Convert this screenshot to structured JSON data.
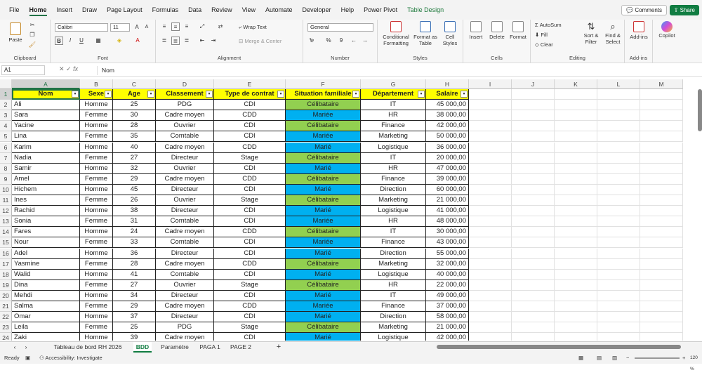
{
  "menu": [
    "File",
    "Home",
    "Insert",
    "Draw",
    "Page Layout",
    "Formulas",
    "Data",
    "Review",
    "View",
    "Automate",
    "Developer",
    "Help",
    "Power Pivot",
    "Table Design"
  ],
  "buttons": {
    "comments": "Comments",
    "share": "Share"
  },
  "ribbon": {
    "clipboard": {
      "paste": "Paste",
      "label": "Clipboard"
    },
    "font": {
      "name": "Calibri",
      "size": "11",
      "label": "Font",
      "bold": "B",
      "italic": "I",
      "underline": "U"
    },
    "alignment": {
      "wrap": "Wrap Text",
      "merge": "Merge & Center",
      "label": "Alignment"
    },
    "number": {
      "format": "General",
      "label": "Number",
      "percent": "%",
      "comma": "9"
    },
    "styles": {
      "conditional": "Conditional Formatting",
      "format_table": "Format as Table",
      "cell_styles": "Cell Styles",
      "label": "Styles"
    },
    "cells": {
      "insert": "Insert",
      "delete": "Delete",
      "format": "Format",
      "label": "Cells"
    },
    "editing": {
      "autosum": "AutoSum",
      "fill": "Fill",
      "clear": "Clear",
      "sort": "Sort & Filter",
      "find": "Find & Select",
      "label": "Editing"
    },
    "addins": {
      "addins": "Add-ins",
      "label": "Add-ins"
    },
    "copilot": {
      "label": "Copilot"
    }
  },
  "formula_bar": {
    "cell_ref": "A1",
    "fx": "fx",
    "value": "Nom"
  },
  "columns": [
    "A",
    "B",
    "C",
    "D",
    "E",
    "F",
    "G",
    "H",
    "I",
    "J",
    "K",
    "L",
    "M"
  ],
  "headers": [
    "Nom",
    "Sexe",
    "Age",
    "Classement",
    "Type de contrat",
    "Situation familiale",
    "Département",
    "Salaire"
  ],
  "rows": [
    [
      "Ali",
      "Homme",
      "25",
      "PDG",
      "CDI",
      "Célibataire",
      "IT",
      "45 000,00"
    ],
    [
      "Sara",
      "Femme",
      "30",
      "Cadre moyen",
      "CDD",
      "Mariée",
      "HR",
      "38 000,00"
    ],
    [
      "Yacine",
      "Homme",
      "28",
      "Ouvrier",
      "CDI",
      "Célibataire",
      "Finance",
      "42 000,00"
    ],
    [
      "Lina",
      "Femme",
      "35",
      "Comtable",
      "CDI",
      "Mariée",
      "Marketing",
      "50 000,00"
    ],
    [
      "Karim",
      "Homme",
      "40",
      "Cadre moyen",
      "CDD",
      "Marié",
      "Logistique",
      "36 000,00"
    ],
    [
      "Nadia",
      "Femme",
      "27",
      "Directeur",
      "Stage",
      "Célibataire",
      "IT",
      "20 000,00"
    ],
    [
      "Samir",
      "Homme",
      "32",
      "Ouvrier",
      "CDI",
      "Marié",
      "HR",
      "47 000,00"
    ],
    [
      "Amel",
      "Femme",
      "29",
      "Cadre moyen",
      "CDD",
      "Célibataire",
      "Finance",
      "39 000,00"
    ],
    [
      "Hichem",
      "Homme",
      "45",
      "Directeur",
      "CDI",
      "Marié",
      "Direction",
      "60 000,00"
    ],
    [
      "Ines",
      "Femme",
      "26",
      "Ouvrier",
      "Stage",
      "Célibataire",
      "Marketing",
      "21 000,00"
    ],
    [
      "Rachid",
      "Homme",
      "38",
      "Directeur",
      "CDI",
      "Marié",
      "Logistique",
      "41 000,00"
    ],
    [
      "Sonia",
      "Femme",
      "31",
      "Comtable",
      "CDI",
      "Mariée",
      "HR",
      "48 000,00"
    ],
    [
      "Fares",
      "Homme",
      "24",
      "Cadre moyen",
      "CDD",
      "Célibataire",
      "IT",
      "30 000,00"
    ],
    [
      "Nour",
      "Femme",
      "33",
      "Comtable",
      "CDI",
      "Mariée",
      "Finance",
      "43 000,00"
    ],
    [
      "Adel",
      "Homme",
      "36",
      "Directeur",
      "CDI",
      "Marié",
      "Direction",
      "55 000,00"
    ],
    [
      "Yasmine",
      "Femme",
      "28",
      "Cadre moyen",
      "CDD",
      "Célibataire",
      "Marketing",
      "32 000,00"
    ],
    [
      "Walid",
      "Homme",
      "41",
      "Comtable",
      "CDI",
      "Marié",
      "Logistique",
      "40 000,00"
    ],
    [
      "Dina",
      "Femme",
      "27",
      "Ouvrier",
      "Stage",
      "Célibataire",
      "HR",
      "22 000,00"
    ],
    [
      "Mehdi",
      "Homme",
      "34",
      "Directeur",
      "CDI",
      "Marié",
      "IT",
      "49 000,00"
    ],
    [
      "Salma",
      "Femme",
      "29",
      "Cadre moyen",
      "CDD",
      "Mariée",
      "Finance",
      "37 000,00"
    ],
    [
      "Omar",
      "Homme",
      "37",
      "Directeur",
      "CDI",
      "Marié",
      "Direction",
      "58 000,00"
    ],
    [
      "Leila",
      "Femme",
      "25",
      "PDG",
      "Stage",
      "Célibataire",
      "Marketing",
      "21 000,00"
    ],
    [
      "Zaki",
      "Homme",
      "39",
      "Cadre moyen",
      "CDI",
      "Marié",
      "Logistique",
      "42 000,00"
    ]
  ],
  "colors": {
    "header_fill": "#ffff00",
    "single_fill": "#92d050",
    "married_fill": "#00b0f0",
    "accent": "#217346"
  },
  "sheet_tabs": [
    "Tableau de bord RH 2026",
    "BDD",
    "Paramètre",
    "PAGA 1",
    "PAGE 2"
  ],
  "active_tab": "BDD",
  "status": {
    "ready": "Ready",
    "accessibility": "Accessibility: Investigate",
    "zoom": "120 %"
  }
}
